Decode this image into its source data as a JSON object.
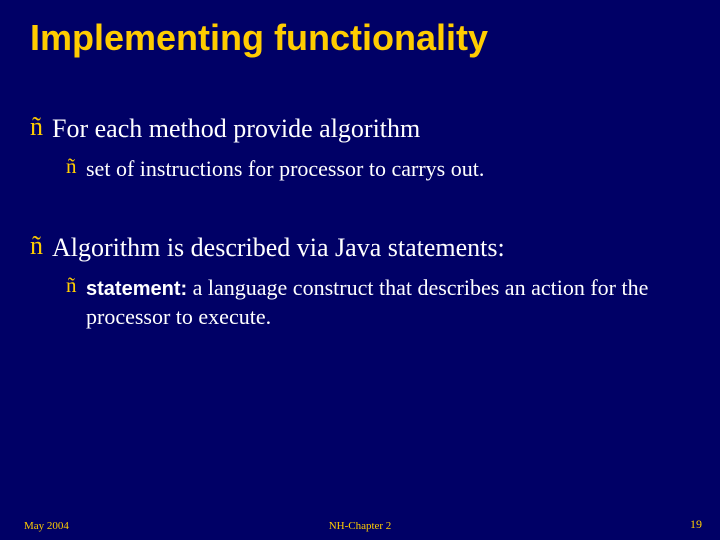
{
  "title": "Implementing functionality",
  "bullets": {
    "b1": "For each method provide algorithm",
    "b1a": "set of instructions for processor to carrys out.",
    "b2": "Algorithm is described via Java statements:",
    "b3_term": "statement:",
    "b3_text": " a language construct that describes an action for the processor to execute."
  },
  "marker": "ñ",
  "footer": {
    "left": "May 2004",
    "center": "NH-Chapter 2",
    "right": "19"
  }
}
